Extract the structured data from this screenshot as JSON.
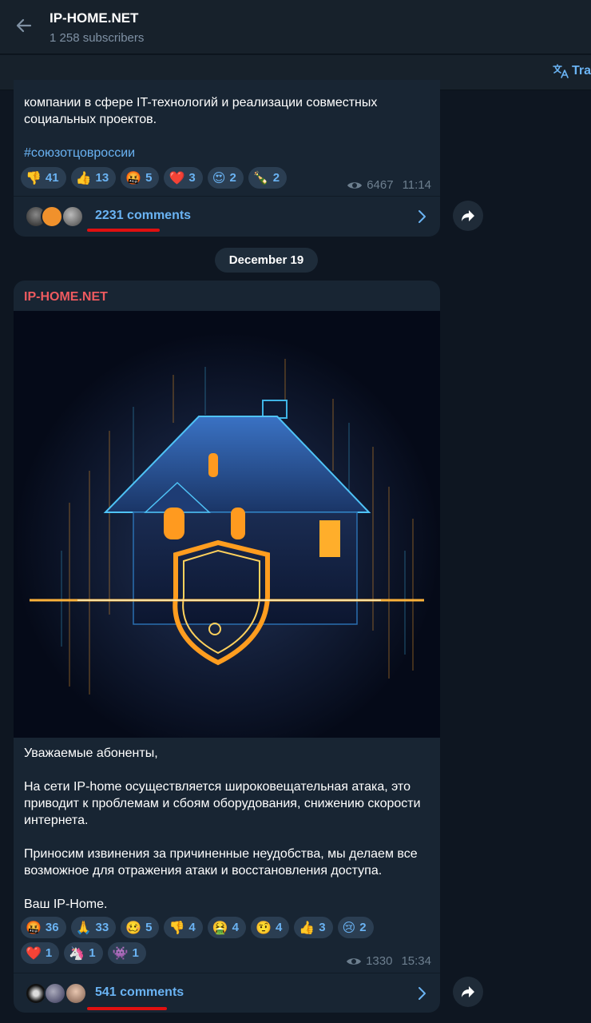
{
  "header": {
    "title": "IP-HOME.NET",
    "subtitle": "1 258 subscribers",
    "translate_label": "Tra"
  },
  "post1": {
    "partial_text": "компании в сфере IT-технологий и реализации совместных социальных проектов.",
    "hashtag": "#союзотцовроссии",
    "reactions": [
      {
        "emoji": "👎",
        "count": "41"
      },
      {
        "emoji": "👍",
        "count": "13"
      },
      {
        "emoji": "🤬",
        "count": "5"
      },
      {
        "emoji": "❤️",
        "count": "3"
      },
      {
        "emoji": "😍",
        "count": "2"
      },
      {
        "emoji": "🍾",
        "count": "2"
      }
    ],
    "views": "6467",
    "time": "11:14",
    "comments": "2231 comments"
  },
  "date_separator": "December 19",
  "post2": {
    "sender": "IP-HOME.NET",
    "paragraphs": [
      "Уважаемые абоненты,",
      "На сети IP-home осуществляется широковещательная атака, это приводит к проблемам и сбоям оборудования, снижению скорости интернета.",
      "Приносим извинения за причиненные неудобства, мы делаем все возможное для отражения атаки и восстановления доступа.",
      "Ваш IP-Home."
    ],
    "reactions": [
      {
        "emoji": "🤬",
        "count": "36"
      },
      {
        "emoji": "🙏",
        "count": "33"
      },
      {
        "emoji": "🥴",
        "count": "5"
      },
      {
        "emoji": "👎",
        "count": "4"
      },
      {
        "emoji": "🤮",
        "count": "4"
      },
      {
        "emoji": "🤨",
        "count": "4"
      },
      {
        "emoji": "👍",
        "count": "3"
      },
      {
        "emoji": "😢",
        "count": "2"
      },
      {
        "emoji": "❤️",
        "count": "1"
      },
      {
        "emoji": "🦄",
        "count": "1"
      },
      {
        "emoji": "👾",
        "count": "1"
      }
    ],
    "views": "1330",
    "time": "15:34",
    "comments": "541 comments"
  },
  "colors": {
    "accent": "#6ab3f3",
    "sender": "#ee5a5f",
    "bubble": "#182533",
    "background": "#0e1621",
    "annotation_underline": "#e01010"
  }
}
